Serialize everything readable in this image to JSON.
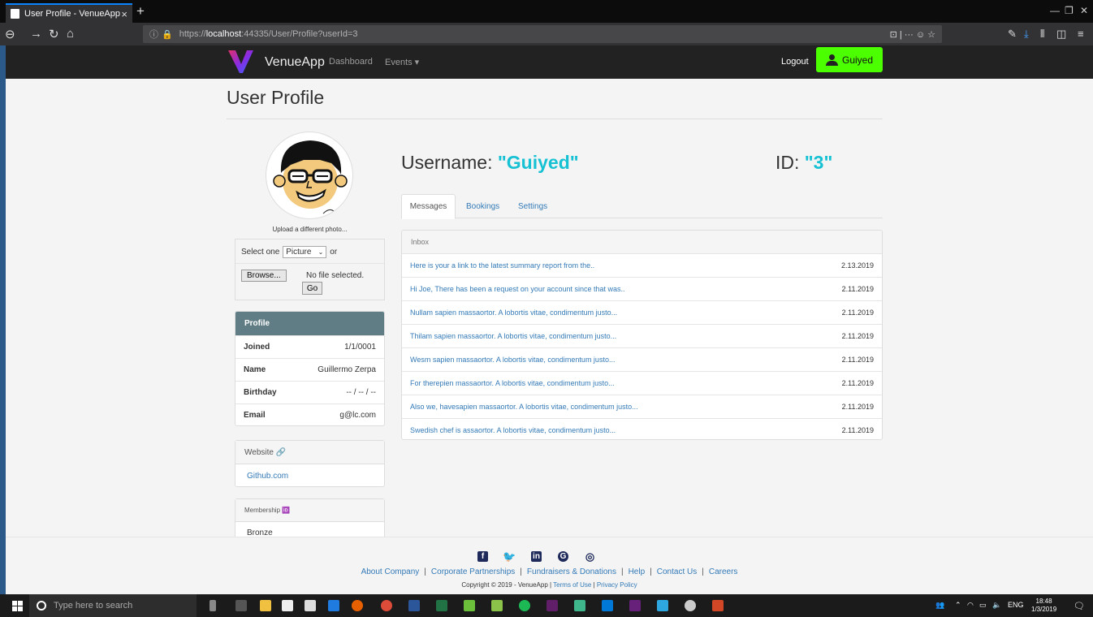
{
  "browser": {
    "tab_title": "User Profile - VenueApp",
    "tab_close": "×",
    "new_tab": "+",
    "url_prefix": "https://",
    "url_host": "localhost",
    "url_rest": ":44335/User/Profile?userId=3",
    "url_right": "⊡ | ··· ☺ ☆"
  },
  "site_nav": {
    "brand": "VenueApp",
    "dashboard": "Dashboard",
    "events": "Events ▾",
    "logout": "Logout",
    "user": "Guiyed"
  },
  "page": {
    "title": "User Profile",
    "username_label": "Username: ",
    "username_value": "\"Guiyed\"",
    "id_label": "ID: ",
    "id_value": "\"3\""
  },
  "upload": {
    "text": "Upload a different photo...",
    "select_label": "Select one",
    "select_value": "Picture",
    "or": "or",
    "browse": "Browse...",
    "no_file": "No file selected.",
    "go": "Go"
  },
  "profile": {
    "header": "Profile",
    "rows": [
      {
        "k": "Joined",
        "v": "1/1/0001"
      },
      {
        "k": "Name",
        "v": "Guillermo Zerpa"
      },
      {
        "k": "Birthday",
        "v": "-- / -- / --"
      },
      {
        "k": "Email",
        "v": "g@lc.com"
      }
    ]
  },
  "website": {
    "header": "Website 🔗",
    "link": "Github.com"
  },
  "membership": {
    "header": "Membership 🆔",
    "value": "Bronze"
  },
  "tabs": [
    "Messages",
    "Bookings",
    "Settings"
  ],
  "inbox": {
    "header": "Inbox",
    "messages": [
      {
        "subject": "Here is your a link to the latest summary report from the..",
        "date": "2.13.2019"
      },
      {
        "subject": "Hi Joe, There has been a request on your account since that was..",
        "date": "2.11.2019"
      },
      {
        "subject": "Nullam sapien massaortor. A lobortis vitae, condimentum justo...",
        "date": "2.11.2019"
      },
      {
        "subject": "Thilam sapien massaortor. A lobortis vitae, condimentum justo...",
        "date": "2.11.2019"
      },
      {
        "subject": "Wesm sapien massaortor. A lobortis vitae, condimentum justo...",
        "date": "2.11.2019"
      },
      {
        "subject": "For therepien massaortor. A lobortis vitae, condimentum justo...",
        "date": "2.11.2019"
      },
      {
        "subject": "Also we, havesapien massaortor. A lobortis vitae, condimentum justo...",
        "date": "2.11.2019"
      },
      {
        "subject": "Swedish chef is assaortor. A lobortis vitae, condimentum justo...",
        "date": "2.11.2019"
      }
    ]
  },
  "footer": {
    "links": [
      "About Company",
      "Corporate Partnerships",
      "Fundraisers & Donations",
      "Help",
      "Contact Us",
      "Careers"
    ],
    "copyright": "Copyright © 2019 - VenueApp | ",
    "terms": "Terms of Use",
    "sep": " | ",
    "privacy": "Privacy Policy"
  },
  "taskbar": {
    "search_placeholder": "Type here to search",
    "lang": "ENG",
    "time": "18:48",
    "date": "1/3/2019"
  },
  "colors": {
    "accent": "#17c1d4",
    "user_button": "#4cff00",
    "profile_header": "#607d85",
    "link": "#337ab7"
  }
}
